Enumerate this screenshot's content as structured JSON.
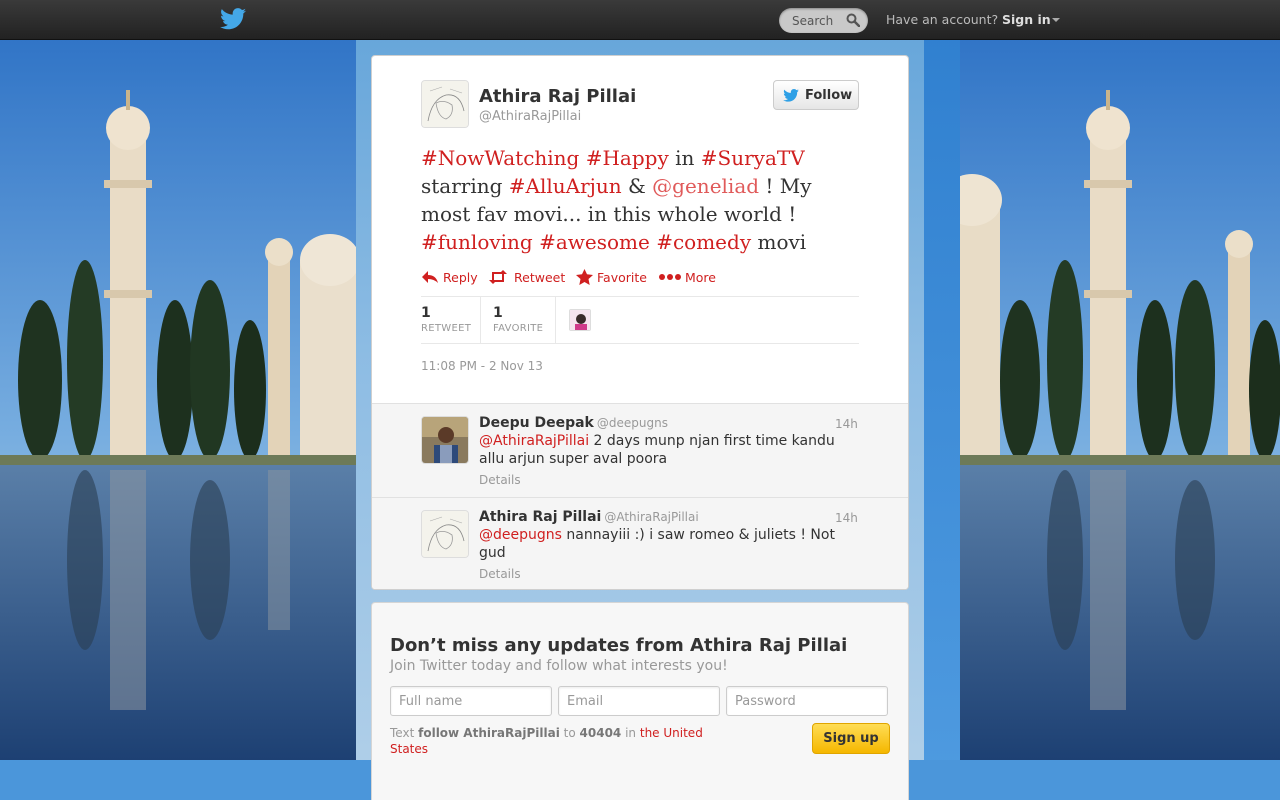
{
  "topbar": {
    "search_placeholder": "Search",
    "have_account": "Have an account?",
    "sign_in": "Sign in"
  },
  "tweet": {
    "author_name": "Athira Raj Pillai",
    "author_handle": "@AthiraRajPillai",
    "follow_label": "Follow",
    "text": {
      "t1": "#NowWatching",
      "t2": " ",
      "t3": "#Happy",
      "t4": " in ",
      "t5": "#SuryaTV",
      "t6": " starring ",
      "t7": "#AlluArjun",
      "t8": " & ",
      "t9": "@geneliad",
      "t10": " ! My most fav movi... in this whole world ! ",
      "t11": "#funloving",
      "t12": " ",
      "t13": "#awesome",
      "t14": " ",
      "t15": "#comedy",
      "t16": " movi"
    },
    "actions": {
      "reply": "Reply",
      "retweet": "Retweet",
      "favorite": "Favorite",
      "more": "More"
    },
    "stats": {
      "retweet_count": "1",
      "retweet_label": "RETWEET",
      "favorite_count": "1",
      "favorite_label": "FAVORITE"
    },
    "timestamp": "11:08 PM - 2 Nov 13"
  },
  "replies": [
    {
      "name": "Deepu Deepak",
      "handle": "@deepugns",
      "time": "14h",
      "mention": "@AthiraRajPillai",
      "text": " 2 days munp njan first time kandu allu arjun super aval poora",
      "details": "Details"
    },
    {
      "name": "Athira Raj Pillai",
      "handle": "@AthiraRajPillai",
      "time": "14h",
      "mention": "@deepugns",
      "text": " nannayiii :) i saw romeo & juliets ! Not gud",
      "details": "Details"
    }
  ],
  "signup": {
    "title": "Don’t miss any updates from Athira Raj Pillai",
    "subtitle": "Join Twitter today and follow what interests you!",
    "full_name_placeholder": "Full name",
    "email_placeholder": "Email",
    "password_placeholder": "Password",
    "sms_text": "Text",
    "sms_command": "follow AthiraRajPillai",
    "sms_to": "to",
    "sms_number": "40404",
    "sms_in": "in",
    "sms_country": "the United States",
    "button": "Sign up"
  },
  "colors": {
    "link": "#d02020",
    "topbar": "#2b2b2b",
    "signup_button": "#f5b700"
  }
}
